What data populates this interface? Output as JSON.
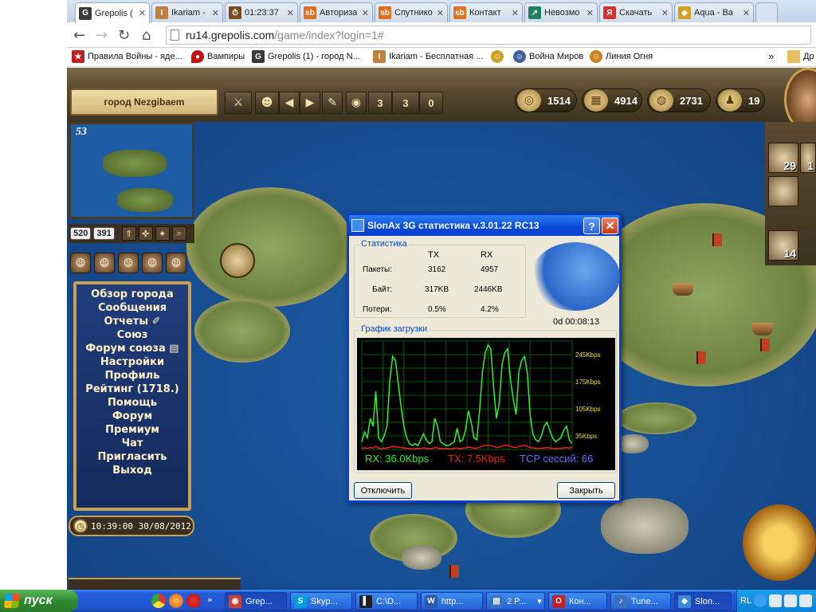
{
  "browser": {
    "tabs": [
      {
        "label": "Grepolis (",
        "icon": "G",
        "color": "#3a3a3a"
      },
      {
        "label": "Ikariam - ",
        "icon": "I",
        "color": "#c08040"
      },
      {
        "label": "01:23:37",
        "icon": "⏱",
        "color": "#7a4a20"
      },
      {
        "label": "Авториза",
        "icon": "sb",
        "color": "#e07020"
      },
      {
        "label": "Спутнико",
        "icon": "sb",
        "color": "#e07020"
      },
      {
        "label": "Контакт",
        "icon": "sb",
        "color": "#e07020"
      },
      {
        "label": "Невозмо",
        "icon": "↗",
        "color": "#208060"
      },
      {
        "label": "Скачать",
        "icon": "Я",
        "color": "#d03030"
      },
      {
        "label": "Aqua - Ва",
        "icon": "◆",
        "color": "#d0a020"
      }
    ],
    "url_host": "ru14.grepolis.com",
    "url_path": "/game/index?login=1#",
    "bookmarks": [
      {
        "label": "Правила Войны - яде...",
        "icon": "★",
        "color": "#c02020"
      },
      {
        "label": "Вампиры",
        "icon": "●",
        "color": "#c01010"
      },
      {
        "label": "Grepolis (1) - город N...",
        "icon": "G",
        "color": "#3a3a3a"
      },
      {
        "label": "Ikariam - Бесплатная ...",
        "icon": "I",
        "color": "#c08040"
      },
      {
        "label": "",
        "icon": "☺",
        "color": "#d0a020"
      },
      {
        "label": "Война Миров",
        "icon": "☺",
        "color": "#4060a0"
      },
      {
        "label": "Линия Огня",
        "icon": "☺",
        "color": "#d08020"
      }
    ],
    "bookmarks_more": "»",
    "other_bookmarks": "Др"
  },
  "game": {
    "city_name": "город Nezgibaem",
    "toolbar": {
      "count_a": "3",
      "count_b": "3",
      "count_c": "0"
    },
    "resources": {
      "wood": "1514",
      "stone": "4914",
      "silver": "2731",
      "population": "19"
    },
    "minimap_sea": "53",
    "coords": {
      "x": "520",
      "y": "391"
    },
    "menu": [
      "Обзор города",
      "Сообщения",
      "Отчеты",
      "Союз",
      "Форум союза",
      "Настройки",
      "Профиль",
      "Рейтинг (1718.)",
      "Помощь",
      "Форум",
      "Премиум",
      "Чат",
      "Пригласить",
      "Выход"
    ],
    "server_time": "10:39:00 30/08/2012",
    "units": {
      "hoplite": "29",
      "ship": "14",
      "partial": "1"
    }
  },
  "dialog": {
    "title": "SlonAx 3G статистика v.3.01.22 RC13",
    "help_label": "?",
    "close_label": "✕",
    "stats_group": "Статистика",
    "col_tx": "TX",
    "col_rx": "RX",
    "rows": [
      {
        "label": "Пакеты:",
        "tx": "3162",
        "rx": "4957"
      },
      {
        "label": "Байт:",
        "tx": "317KB",
        "rx": "2446KB"
      },
      {
        "label": "Потери:",
        "tx": "0.5%",
        "rx": "4.2%"
      }
    ],
    "uptime": "0d 00:08:13",
    "graph_group": "График загрузки",
    "y_ticks": [
      "245Kbps",
      "175Kbps",
      "105Kbps",
      "35Kbps"
    ],
    "legend_rx": "RX: 36.0Kbps",
    "legend_tx": "TX: 7.5Kbps",
    "legend_tcp": "TCP сессий: 66",
    "disconnect_label": "Отключить",
    "close_button_label": "Закрыть"
  },
  "chart_data": {
    "type": "line",
    "ylim": [
      0,
      280
    ],
    "yticks": [
      35,
      105,
      175,
      245
    ],
    "series": [
      {
        "name": "RX",
        "color": "#33ee33",
        "values": [
          20,
          45,
          30,
          80,
          60,
          150,
          30,
          20,
          35,
          60,
          180,
          240,
          230,
          170,
          110,
          60,
          30,
          15,
          10,
          15,
          10,
          25,
          40,
          25,
          15,
          20,
          80,
          60,
          20,
          15,
          10,
          10,
          15,
          20,
          55,
          20,
          25,
          50,
          100,
          70,
          30,
          25,
          100,
          200,
          250,
          270,
          260,
          160,
          80,
          120,
          220,
          250,
          260,
          180,
          130,
          90,
          200,
          230,
          240,
          200,
          90,
          40,
          25,
          20,
          35,
          60,
          70,
          50,
          30,
          20,
          25,
          30,
          50,
          60,
          25,
          15
        ]
      },
      {
        "name": "TX",
        "color": "#ee2020",
        "values": [
          3,
          4,
          3,
          5,
          4,
          8,
          3,
          2,
          3,
          4,
          6,
          8,
          7,
          6,
          5,
          4,
          3,
          2,
          2,
          2,
          2,
          3,
          4,
          3,
          2,
          2,
          5,
          4,
          2,
          2,
          2,
          2,
          2,
          3,
          4,
          2,
          3,
          4,
          6,
          5,
          3,
          3,
          6,
          9,
          10,
          11,
          10,
          8,
          5,
          6,
          9,
          10,
          11,
          8,
          6,
          5,
          8,
          9,
          10,
          8,
          5,
          4,
          3,
          3,
          3,
          4,
          5,
          4,
          3,
          2,
          3,
          3,
          4,
          5,
          3,
          7
        ]
      }
    ]
  },
  "taskbar": {
    "start_label": "пуск",
    "tasks": [
      {
        "label": "Grep...",
        "icon": "◉",
        "color": "#d04030"
      },
      {
        "label": "Skyp...",
        "icon": "S",
        "color": "#00a0e0"
      },
      {
        "label": "C:\\D...",
        "icon": "▌",
        "color": "#202020"
      },
      {
        "label": "http...",
        "icon": "W",
        "color": "#2a5aa8"
      },
      {
        "label": "2 P...",
        "icon": "▤",
        "color": "#3a70c0"
      },
      {
        "label": "Кон...",
        "icon": "O",
        "color": "#c02020"
      },
      {
        "label": "Tune...",
        "icon": "♪",
        "color": "#3a70c0"
      },
      {
        "label": "Slon...",
        "icon": "◆",
        "color": "#3a8ad8"
      }
    ],
    "lang": "RL"
  }
}
